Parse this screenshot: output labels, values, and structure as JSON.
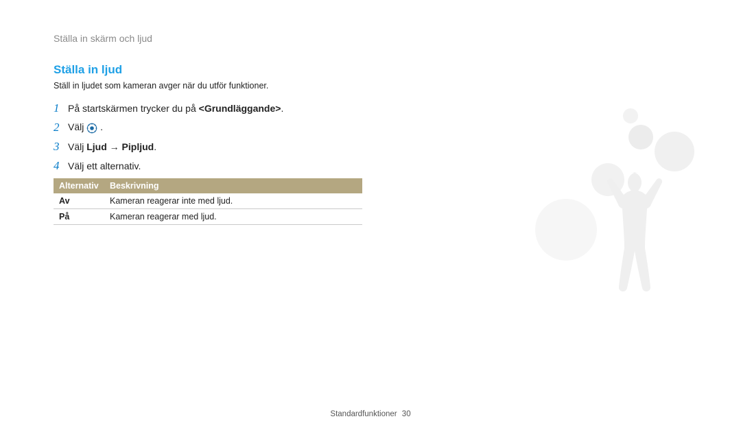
{
  "breadcrumb": "Ställa in skärm och ljud",
  "section_title": "Ställa in ljud",
  "intro": "Ställ in ljudet som kameran avger när du utför funktioner.",
  "steps": {
    "s1_num": "1",
    "s1_prefix": "På startskärmen trycker du på ",
    "s1_bold": "<Grundläggande>",
    "s1_suffix": ".",
    "s2_num": "2",
    "s2_text_before": "Välj ",
    "s2_text_after": " .",
    "s3_num": "3",
    "s3_prefix": "Välj ",
    "s3_bold": "Ljud → Pipljud",
    "s3_suffix": ".",
    "s4_num": "4",
    "s4_text": "Välj ett alternativ."
  },
  "table": {
    "header_alt": "Alternativ",
    "header_desc": "Beskrivning",
    "rows": [
      {
        "alt": "Av",
        "desc": "Kameran reagerar inte med ljud."
      },
      {
        "alt": "På",
        "desc": "Kameran reagerar med ljud."
      }
    ]
  },
  "footer_label": "Standardfunktioner",
  "footer_page": "30"
}
